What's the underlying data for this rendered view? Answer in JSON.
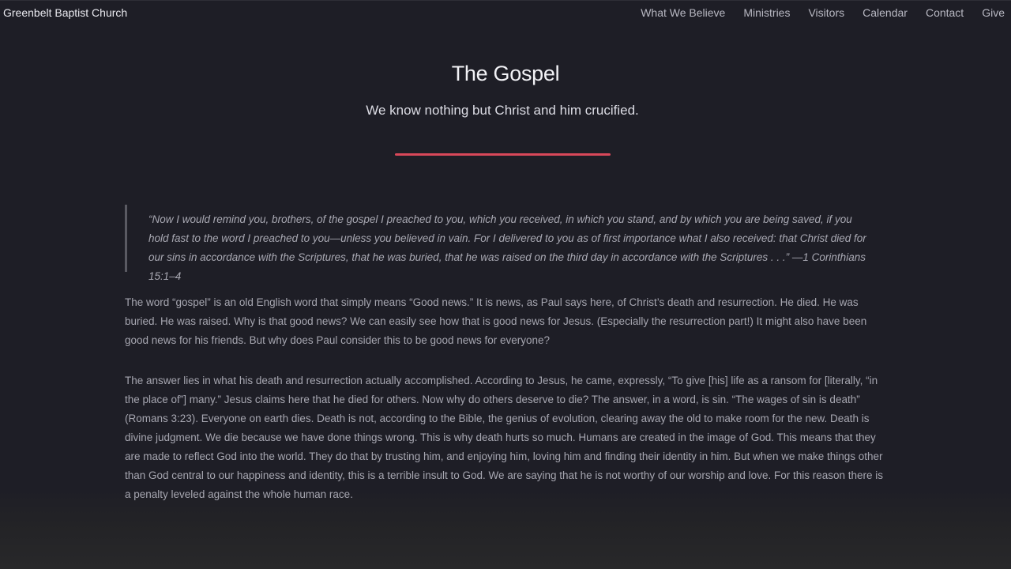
{
  "header": {
    "brand": "Greenbelt Baptist Church",
    "nav": [
      {
        "label": "What We Believe"
      },
      {
        "label": "Ministries"
      },
      {
        "label": "Visitors"
      },
      {
        "label": "Calendar"
      },
      {
        "label": "Contact"
      },
      {
        "label": "Give"
      }
    ]
  },
  "hero": {
    "title": "The Gospel",
    "subtitle": "We know nothing but Christ and him crucified."
  },
  "content": {
    "quote": "“Now I would remind you, brothers, of the gospel I preached to you, which you received, in which you stand, and by which you are being saved, if you hold fast to the word I preached to you—unless you believed in vain. For I delivered to you as of first importance what I also received: that Christ died for our sins in accordance with the Scriptures, that he was buried, that he was raised on the third day in accordance with the Scriptures . . .” —1 Corinthians 15:1–4",
    "paragraphs": [
      "The word “gospel” is an old English word that simply means “Good news.” It is news, as Paul says here, of Christ’s death and resurrection. He died. He was buried. He was raised. Why is that good news? We can easily see how that is good news for Jesus. (Especially the resurrection part!) It might also have been good news for his friends. But why does Paul consider this to be good news for everyone?",
      "The answer lies in what his death and resurrection actually accomplished. According to Jesus, he came, expressly, “To give [his] life as a ransom for [literally, “in the place of”] many.” Jesus claims here that he died for others. Now why do others deserve to die? The answer, in a word, is sin. “The wages of sin is death” (Romans 3:23). Everyone on earth dies. Death is not, according to the Bible, the genius of evolution, clearing away the old to make room for the new. Death is divine judgment. We die because we have done things wrong. This is why death hurts so much. Humans are created in the image of God. This means that they are made to reflect God into the world. They do that by trusting him, and enjoying him, loving him and finding their identity in him. But when we make things other than God central to our happiness and identity, this is a terrible insult to God. We are saying that he is not worthy of our worship and love. For this reason there is a penalty leveled against the whole human race."
    ]
  },
  "colors": {
    "background": "#1e1e26",
    "accent": "#d9485a",
    "text": "#a6a6b0"
  }
}
